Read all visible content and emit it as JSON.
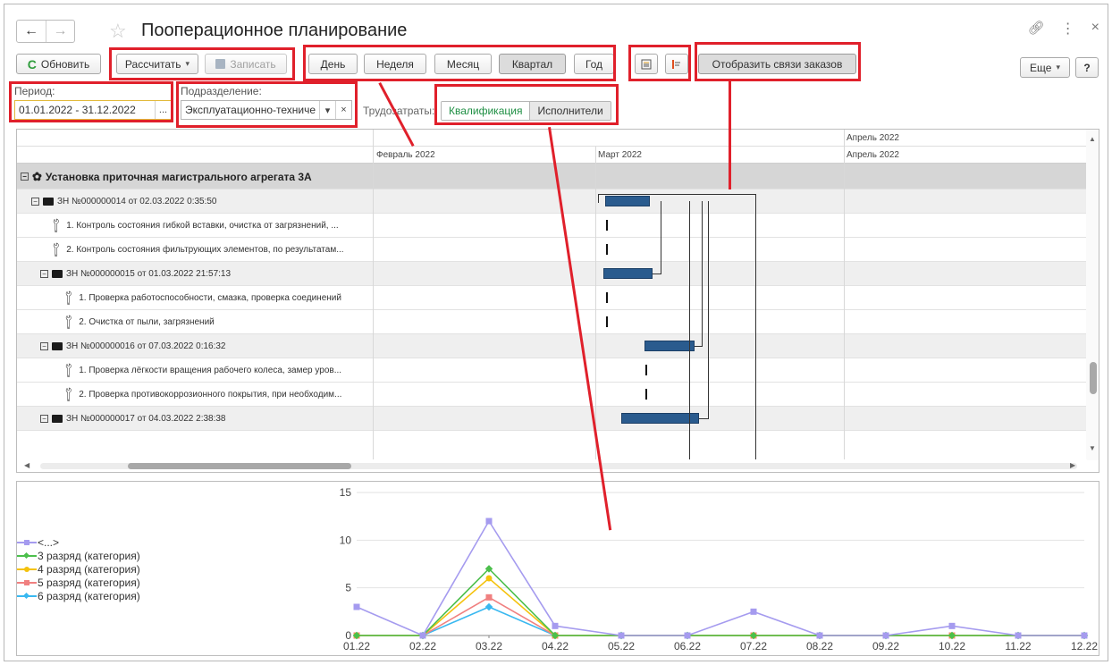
{
  "window": {
    "title": "Пооперационное планирование",
    "nav_back": "←",
    "nav_forward": "→",
    "star": "☆",
    "link_icon": "🔗",
    "more_icon": "⋮",
    "close_icon": "×"
  },
  "toolbar": {
    "refresh_label": "Обновить",
    "calculate_label": "Рассчитать",
    "save_label": "Записать",
    "day_label": "День",
    "week_label": "Неделя",
    "month_label": "Месяц",
    "quarter_label": "Квартал",
    "year_label": "Год",
    "show_links_label": "Отобразить связи заказов",
    "more_label": "Еще",
    "help_label": "?"
  },
  "filters": {
    "period_label": "Период:",
    "period_value": "01.01.2022 - 31.12.2022",
    "period_btn": "...",
    "division_label": "Подразделение:",
    "division_value": "Эксплуатационно-техниче",
    "labor_label": "Трудозатраты:",
    "seg_qualification": "Квалификация",
    "seg_performers": "Исполнители"
  },
  "gantt": {
    "header_top_april": "Апрель 2022",
    "header_feb": "Февраль 2022",
    "header_mar": "Март 2022",
    "header_apr": "Апрель 2022",
    "rows": [
      {
        "label": "Установка приточная магистрального агрегата 3А"
      },
      {
        "label": "ЗН №000000014 от 02.03.2022 0:35:50"
      },
      {
        "label": "1. Контроль состояния гибкой вставки, очистка от загрязнений, ..."
      },
      {
        "label": "2. Контроль состояния фильтрующих элементов, по результатам..."
      },
      {
        "label": "ЗН №000000015 от 01.03.2022 21:57:13"
      },
      {
        "label": "1. Проверка работоспособности, смазка, проверка соединений"
      },
      {
        "label": "2. Очистка от пыли, загрязнений"
      },
      {
        "label": "ЗН №000000016 от 07.03.2022 0:16:32"
      },
      {
        "label": "1. Проверка лёгкости вращения рабочего колеса, замер уров..."
      },
      {
        "label": "2. Проверка противокоррозионного покрытия, при необходим..."
      },
      {
        "label": "ЗН №000000017 от 04.03.2022 2:38:38"
      }
    ]
  },
  "chart_data": {
    "type": "line",
    "categories": [
      "01.22",
      "02.22",
      "03.22",
      "04.22",
      "05.22",
      "06.22",
      "07.22",
      "08.22",
      "09.22",
      "10.22",
      "11.22",
      "12.22"
    ],
    "ylim": [
      0,
      15
    ],
    "yticks": [
      "0",
      "5",
      "10",
      "15"
    ],
    "legend_position": "left",
    "series": [
      {
        "name": "<...>",
        "color": "#a59bef",
        "values": [
          3,
          0,
          12,
          1,
          0,
          0,
          2.5,
          0,
          0,
          1,
          0,
          0
        ]
      },
      {
        "name": "3 разряд (категория)",
        "color": "#4cbf4c",
        "values": [
          0,
          0,
          7,
          0,
          0,
          0,
          0,
          0,
          0,
          0,
          0,
          0
        ]
      },
      {
        "name": "4 разряд (категория)",
        "color": "#f4c20d",
        "values": [
          0,
          0,
          6,
          0,
          0,
          0,
          0,
          0,
          0,
          0,
          0,
          0
        ]
      },
      {
        "name": "5 разряд (категория)",
        "color": "#f08080",
        "values": [
          0,
          0,
          4,
          0,
          0,
          0,
          0,
          0,
          0,
          0,
          0,
          0
        ]
      },
      {
        "name": "6 разряд (категория)",
        "color": "#39b8f0",
        "values": [
          0,
          0,
          3,
          0,
          0,
          0,
          0,
          0,
          0,
          0,
          0,
          0
        ]
      }
    ]
  }
}
